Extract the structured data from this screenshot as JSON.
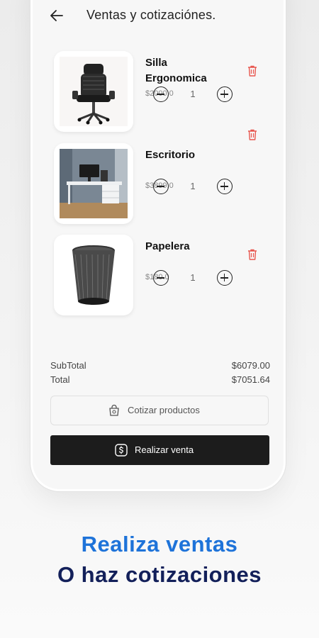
{
  "header": {
    "title": "Ventas y cotizaciónes."
  },
  "items": [
    {
      "name": "Silla Ergonomica",
      "price": "$2000.0",
      "qty": "1",
      "image": "office-chair"
    },
    {
      "name": "Escritorio",
      "price": "$3899.0",
      "qty": "1",
      "image": "desk"
    },
    {
      "name": "Papelera",
      "price": "$180.0",
      "qty": "1",
      "image": "wastebasket"
    }
  ],
  "totals": {
    "subtotal_label": "SubTotal",
    "subtotal_value": "$6079.00",
    "total_label": "Total",
    "total_value": "$7051.64"
  },
  "actions": {
    "quote_label": "Cotizar productos",
    "sale_label": "Realizar venta"
  },
  "promo": {
    "line1": "Realiza ventas",
    "line2": "O haz cotizaciones"
  },
  "colors": {
    "accent_blue": "#1e73d9",
    "navy": "#13205a",
    "trash_red": "#e8574f",
    "primary_button": "#1c1c1c"
  }
}
